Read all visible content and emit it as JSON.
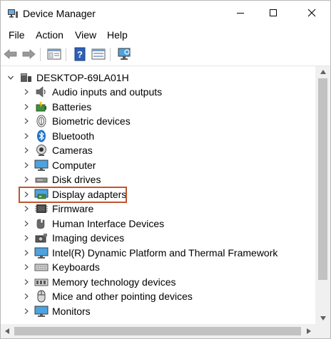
{
  "window": {
    "title": "Device Manager"
  },
  "menu": [
    "File",
    "Action",
    "View",
    "Help"
  ],
  "toolbar": {
    "buttons": [
      "back-arrow-icon",
      "forward-arrow-icon",
      "properties-icon",
      "help-icon",
      "update-driver-icon",
      "monitor-scan-icon"
    ]
  },
  "tree": {
    "root": {
      "label": "DESKTOP-69LA01H",
      "expanded": true
    },
    "items": [
      {
        "label": "Audio inputs and outputs",
        "icon": "speaker-icon"
      },
      {
        "label": "Batteries",
        "icon": "battery-icon"
      },
      {
        "label": "Biometric devices",
        "icon": "fingerprint-icon"
      },
      {
        "label": "Bluetooth",
        "icon": "bluetooth-icon"
      },
      {
        "label": "Cameras",
        "icon": "camera-icon"
      },
      {
        "label": "Computer",
        "icon": "computer-icon"
      },
      {
        "label": "Disk drives",
        "icon": "disk-drive-icon"
      },
      {
        "label": "Display adapters",
        "icon": "display-adapter-icon",
        "highlighted": true
      },
      {
        "label": "Firmware",
        "icon": "firmware-icon"
      },
      {
        "label": "Human Interface Devices",
        "icon": "hid-icon"
      },
      {
        "label": "Imaging devices",
        "icon": "imaging-device-icon"
      },
      {
        "label": "Intel(R) Dynamic Platform and Thermal Framework",
        "icon": "intel-device-icon"
      },
      {
        "label": "Keyboards",
        "icon": "keyboard-icon"
      },
      {
        "label": "Memory technology devices",
        "icon": "memory-device-icon"
      },
      {
        "label": "Mice and other pointing devices",
        "icon": "mouse-icon"
      },
      {
        "label": "Monitors",
        "icon": "monitor-icon"
      }
    ]
  },
  "colors": {
    "highlight_border": "#c0562d",
    "accent_blue": "#1e73c8"
  }
}
